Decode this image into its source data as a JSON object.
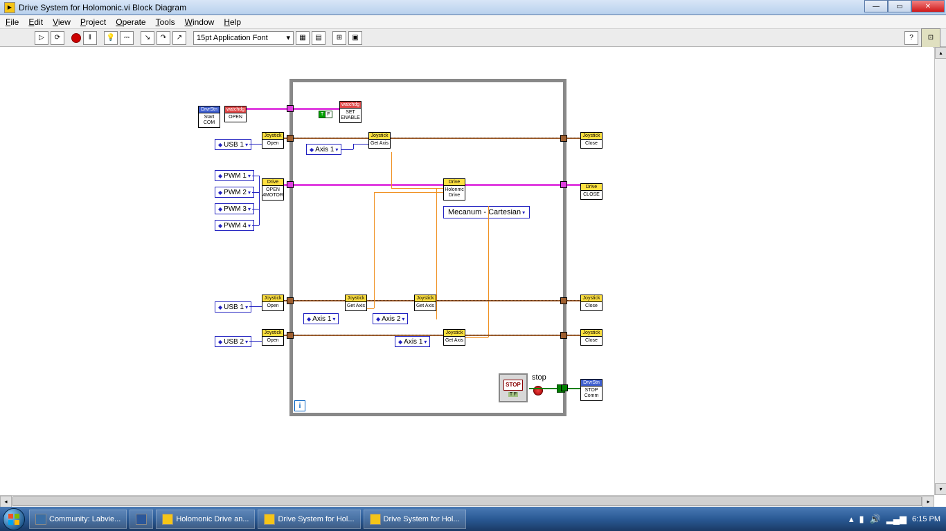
{
  "window": {
    "title": "Drive System for Holomonic.vi Block Diagram"
  },
  "menu": [
    "File",
    "Edit",
    "View",
    "Project",
    "Operate",
    "Tools",
    "Window",
    "Help"
  ],
  "toolbar": {
    "font": "15pt Application Font"
  },
  "nodes": {
    "drvrstn_start": {
      "hdr": "DrvrStn",
      "bdy": "Start\nCOM"
    },
    "watchdog_open": {
      "hdr": "watchdg",
      "bdy": "OPEN"
    },
    "watchdog_enable": {
      "hdr": "watchdg",
      "bdy": "SET\nENABLE"
    },
    "joy_open": {
      "hdr": "Joystick",
      "bdy": "Open"
    },
    "joy_getaxis": {
      "hdr": "Joystick",
      "bdy": "Get\nAxis"
    },
    "joy_close": {
      "hdr": "Joystick",
      "bdy": "Close"
    },
    "drive_open": {
      "hdr": "Drive",
      "bdy": "OPEN\n4MOTOR"
    },
    "drive_holo": {
      "hdr": "Drive",
      "bdy": "Holonmc\nDrive"
    },
    "drive_close": {
      "hdr": "Drive",
      "bdy": "CLOSE"
    },
    "drvrstn_stop": {
      "hdr": "DrvrStn",
      "bdy": "STOP\nComm"
    }
  },
  "rings": {
    "usb1": "USB 1",
    "usb2": "USB 2",
    "pwm1": "PWM 1",
    "pwm2": "PWM 2",
    "pwm3": "PWM 3",
    "pwm4": "PWM 4",
    "axis1": "Axis 1",
    "axis2": "Axis 2",
    "mecanum": "Mecanum - Cartesian"
  },
  "stop": {
    "btn": "STOP",
    "tab": "T F",
    "label": "stop"
  },
  "loop": {
    "iter": "i"
  },
  "taskbar": {
    "items": [
      {
        "label": "Community: Labvie...",
        "icon": "ie"
      },
      {
        "label": "",
        "icon": "word"
      },
      {
        "label": "Holomonic Drive an...",
        "icon": "folder"
      },
      {
        "label": "Drive System for Hol...",
        "icon": "lv"
      },
      {
        "label": "Drive System for Hol...",
        "icon": "lv"
      }
    ],
    "time": "6:15 PM"
  }
}
